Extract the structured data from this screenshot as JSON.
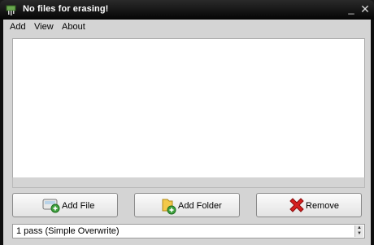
{
  "window": {
    "title": "No files for erasing!"
  },
  "menu": {
    "add": "Add",
    "view": "View",
    "about": "About"
  },
  "buttons": {
    "add_file": "Add File",
    "add_folder": "Add Folder",
    "remove": "Remove"
  },
  "passes": {
    "selected": "1 pass (Simple Overwrite)"
  },
  "icons": {
    "app": "shredder-icon",
    "minimize": "minimize-icon",
    "close": "close-icon",
    "add_file": "add-file-icon",
    "add_folder": "add-folder-icon",
    "remove": "red-x-icon"
  }
}
